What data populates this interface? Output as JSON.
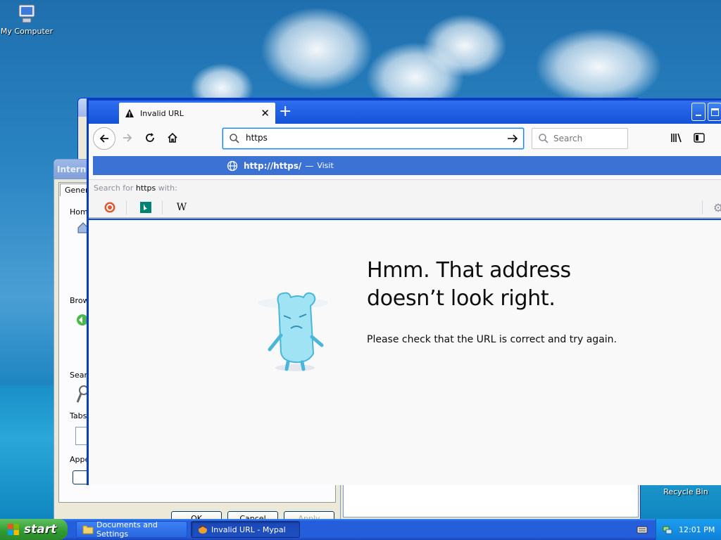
{
  "desktop": {
    "icons": [
      {
        "label": "My Computer",
        "icon": "my-computer-icon"
      },
      {
        "label": "Recycle Bin",
        "icon": "recycle-bin-icon"
      }
    ]
  },
  "internet_options": {
    "title": "Interne",
    "tab": "Genera",
    "sections": [
      "Home",
      "Brow",
      "Sear",
      "Tabs",
      "Appe"
    ],
    "buttons": [
      "OK",
      "Cancel",
      "Apply"
    ]
  },
  "browser": {
    "tab_title": "Invalid URL",
    "tab_icon": "warning-icon",
    "url_value": "https",
    "search_placeholder": "Search",
    "suggestion": {
      "url": "http://https/",
      "separator": "—",
      "action": "Visit"
    },
    "search_for": {
      "prefix": "Search for",
      "term": "https",
      "suffix": "with:"
    },
    "engines": [
      "duckduckgo-icon",
      "bing-icon",
      "wikipedia-icon"
    ],
    "wikipedia_glyph": "W",
    "error": {
      "title": "Hmm. That address doesn’t look right.",
      "description": "Please check that the URL is correct and try again."
    },
    "accent_color": "#0a84ff",
    "highlight_color": "#3b72d3"
  },
  "taskbar": {
    "start_label": "start",
    "tasks": [
      {
        "label": "Documents and Settings",
        "icon": "folder-icon",
        "active": false
      },
      {
        "label": "Invalid URL - Mypal",
        "icon": "mypal-icon",
        "active": true
      }
    ],
    "clock": "12:01 PM"
  }
}
